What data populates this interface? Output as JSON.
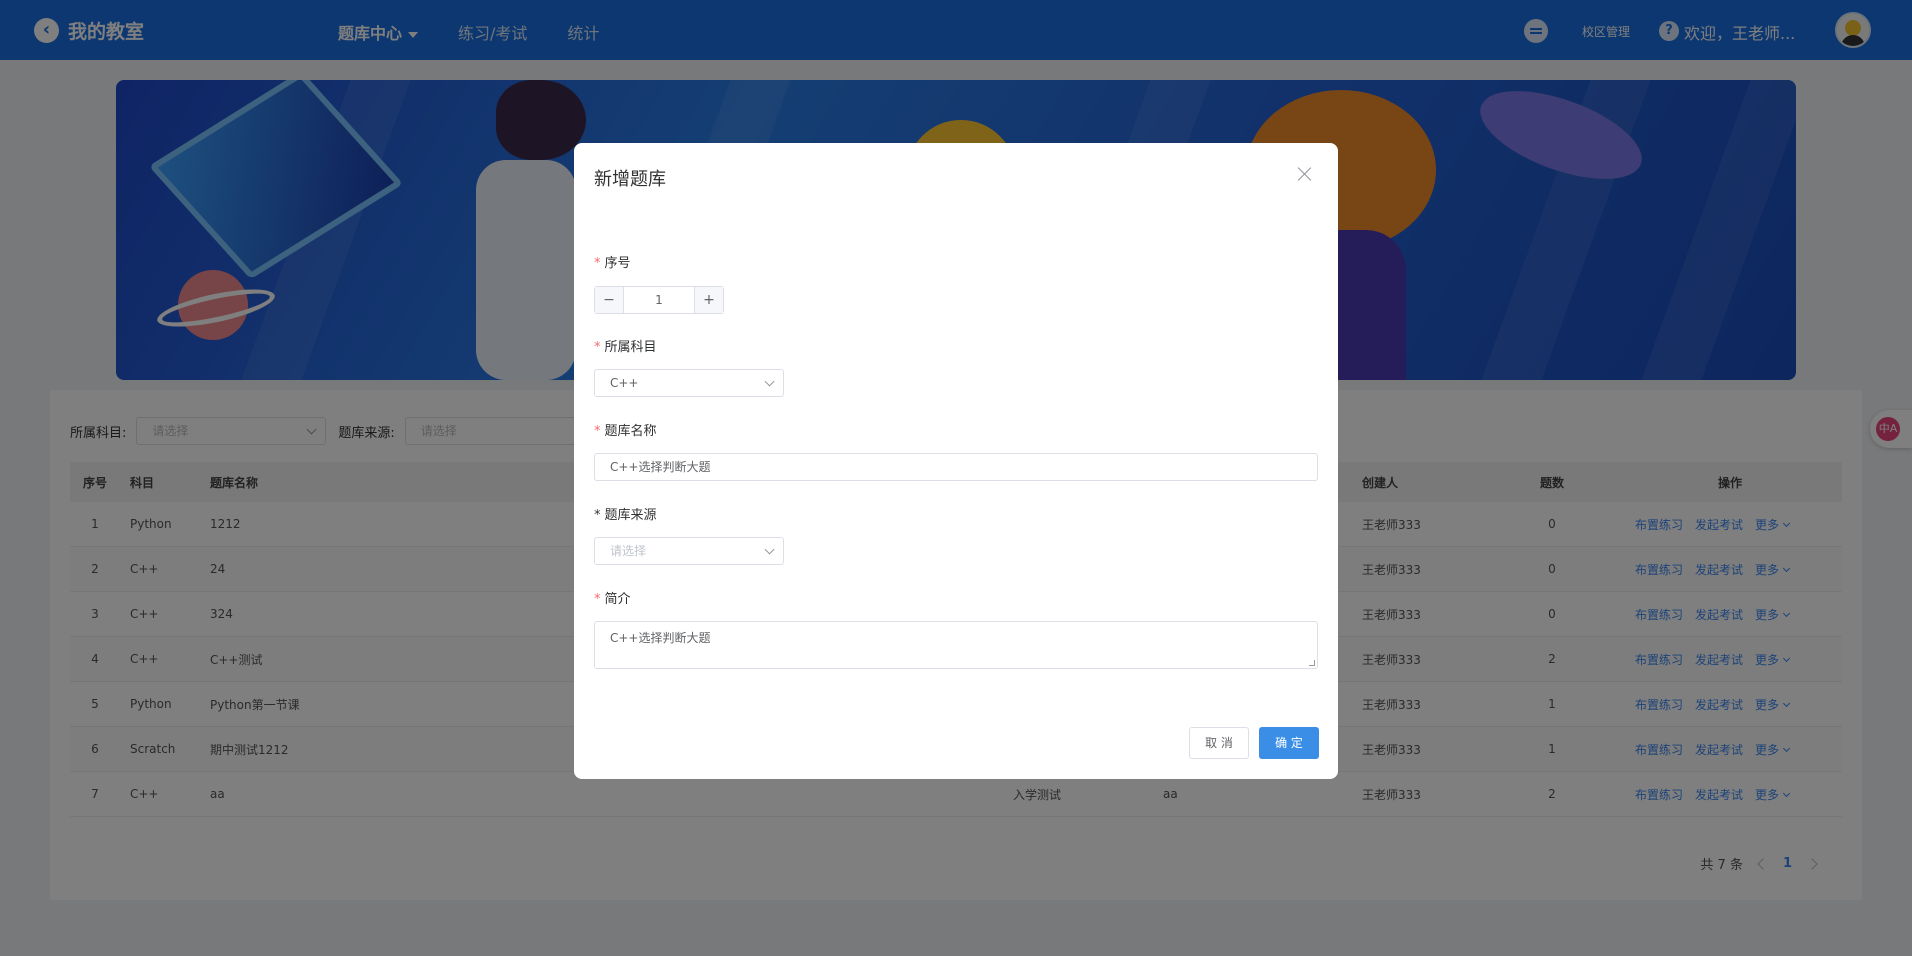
{
  "header": {
    "title": "我的教室",
    "nav": [
      {
        "label": "题库中心",
        "active": true
      },
      {
        "label": "练习/考试",
        "active": false
      },
      {
        "label": "统计",
        "active": false
      }
    ],
    "campus_label": "校区管理",
    "help": "?",
    "welcome": "欢迎，王老师..."
  },
  "filters": {
    "subject_label": "所属科目:",
    "subject_placeholder": "请选择",
    "source_label": "题库来源:",
    "source_placeholder": "请选择"
  },
  "table": {
    "headers": {
      "index": "序号",
      "subject": "科目",
      "name": "题库名称",
      "creator": "创建人",
      "count": "题数",
      "ops": "操作"
    },
    "rows": [
      {
        "index": "1",
        "subject": "Python",
        "name": "1212",
        "tag": "",
        "source": "",
        "creator": "王老师333",
        "count": "0"
      },
      {
        "index": "2",
        "subject": "C++",
        "name": "24",
        "tag": "",
        "source": "",
        "creator": "王老师333",
        "count": "0"
      },
      {
        "index": "3",
        "subject": "C++",
        "name": "324",
        "tag": "",
        "source": "",
        "creator": "王老师333",
        "count": "0"
      },
      {
        "index": "4",
        "subject": "C++",
        "name": "C++测试",
        "tag": "",
        "source": "",
        "creator": "王老师333",
        "count": "2"
      },
      {
        "index": "5",
        "subject": "Python",
        "name": "Python第一节课",
        "tag": "",
        "source": "",
        "creator": "王老师333",
        "count": "1"
      },
      {
        "index": "6",
        "subject": "Scratch",
        "name": "期中测试1212",
        "tag": "",
        "source": "",
        "creator": "王老师333",
        "count": "1"
      },
      {
        "index": "7",
        "subject": "C++",
        "name": "aa",
        "tag": "入学测试",
        "source": "aa",
        "creator": "王老师333",
        "count": "2"
      }
    ],
    "ops": {
      "practice": "布置练习",
      "exam": "发起考试",
      "more": "更多"
    }
  },
  "pagination": {
    "total": "共 7 条",
    "page": "1"
  },
  "modal": {
    "title": "新增题库",
    "fields": {
      "index_label": "序号",
      "index_value": "1",
      "minus": "−",
      "plus": "+",
      "subject_label": "所属科目",
      "subject_value": "C++",
      "name_label": "题库名称",
      "name_value": "C++选择判断大题",
      "source_label": "题库来源",
      "source_placeholder": "请选择",
      "intro_label": "简介",
      "intro_value": "C++选择判断大题"
    },
    "cancel": "取 消",
    "confirm": "确 定"
  },
  "float_badge": "中A",
  "colors": {
    "header": "#1a6fe0",
    "primary": "#3a8ee6",
    "link": "#3a86f0",
    "required": "#f56c6c"
  }
}
